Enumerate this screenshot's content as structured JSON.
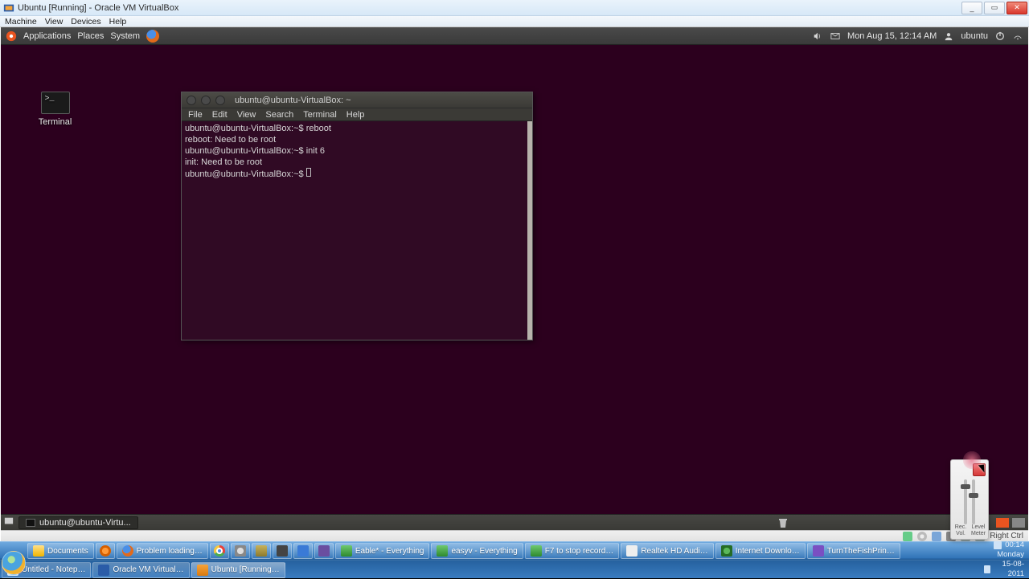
{
  "vb_titlebar": {
    "title": "Ubuntu [Running] - Oracle VM VirtualBox"
  },
  "vb_menu": {
    "m0": "Machine",
    "m1": "View",
    "m2": "Devices",
    "m3": "Help"
  },
  "gnome_top": {
    "apps": "Applications",
    "places": "Places",
    "system": "System",
    "datetime": "Mon Aug 15, 12:14 AM",
    "user": "ubuntu"
  },
  "desktop_icon": {
    "label": "Terminal"
  },
  "terminal": {
    "title": "ubuntu@ubuntu-VirtualBox: ~",
    "menu": {
      "m0": "File",
      "m1": "Edit",
      "m2": "View",
      "m3": "Search",
      "m4": "Terminal",
      "m5": "Help"
    },
    "lines": {
      "l0": "ubuntu@ubuntu-VirtualBox:~$ reboot",
      "l1": "reboot: Need to be root",
      "l2": "ubuntu@ubuntu-VirtualBox:~$ init 6",
      "l3": "init: Need to be root",
      "l4": "ubuntu@ubuntu-VirtualBox:~$ "
    }
  },
  "gnome_bot": {
    "task": "ubuntu@ubuntu-Virtu..."
  },
  "vb_status": {
    "hostkey": "Right Ctrl"
  },
  "win_taskbar": {
    "documents": "Documents",
    "ff": "Problem loading…",
    "ev1": "Eable* - Everything",
    "ev2": "easyv - Everything",
    "f7": "F7 to stop record…",
    "realtek": "Realtek HD Audi…",
    "idm": "Internet Downlo…",
    "fish": "TurnTheFishPrin…",
    "notepad": "Untitled - Notep…",
    "vbox": "Oracle VM Virtual…",
    "vm": "Ubuntu [Running…"
  },
  "recorder": {
    "lbl_rec": "Rec.",
    "lbl_vol": "Vol.",
    "lbl_level": "Level",
    "lbl_meter": "Meter"
  },
  "systray": {
    "time": "00:14",
    "day": "Monday",
    "date": "15-08-2011"
  }
}
